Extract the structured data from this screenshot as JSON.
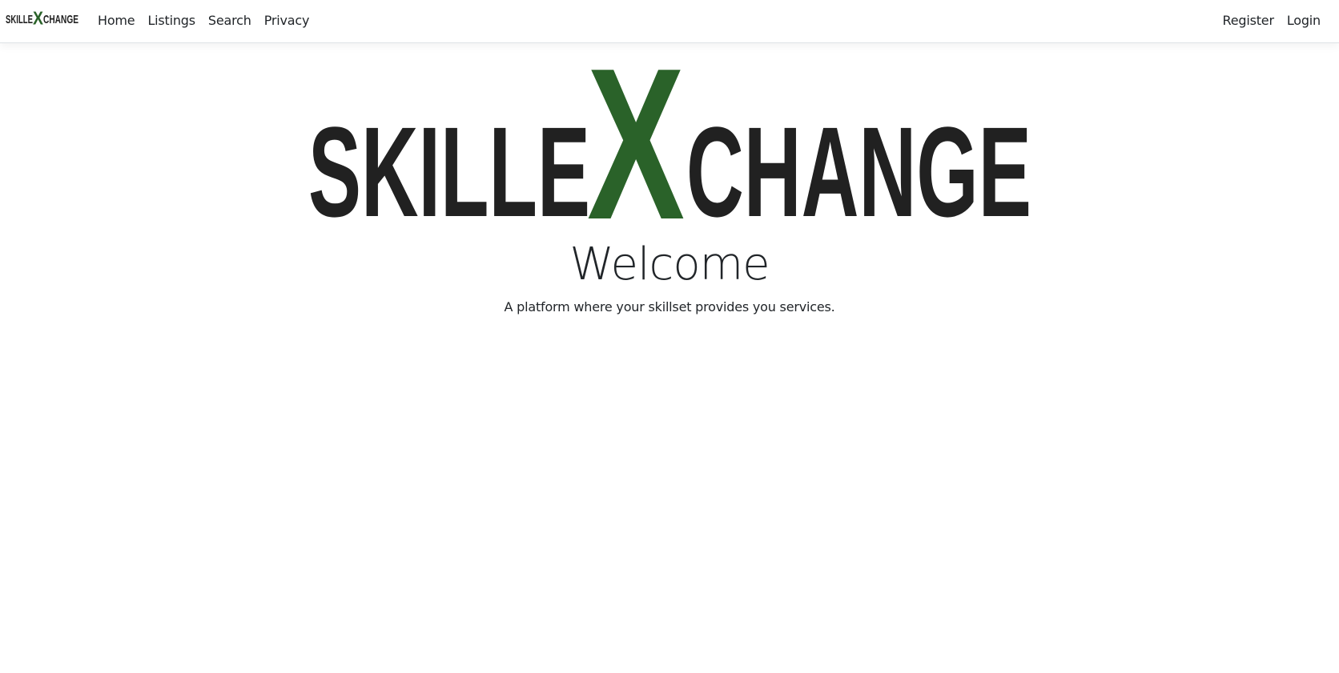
{
  "brand": {
    "logo_text_left": "SKILLE",
    "logo_text_mark": "X",
    "logo_text_right": "CHANGE",
    "colors": {
      "dark": "#212121",
      "green": "#2a6229"
    }
  },
  "nav": {
    "left_items": [
      {
        "label": "Home"
      },
      {
        "label": "Listings"
      },
      {
        "label": "Search"
      },
      {
        "label": "Privacy"
      }
    ],
    "right_items": [
      {
        "label": "Register"
      },
      {
        "label": "Login"
      }
    ]
  },
  "hero": {
    "title": "Welcome",
    "tagline": "A platform where your skillset provides you services."
  }
}
